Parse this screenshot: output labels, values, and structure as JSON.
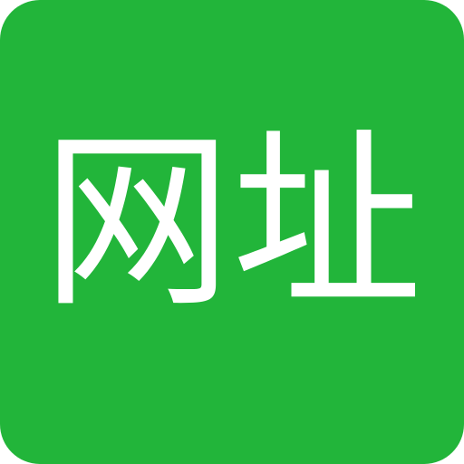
{
  "icon": {
    "label": "网址",
    "background_color": "#22b53a",
    "text_color": "#ffffff"
  }
}
